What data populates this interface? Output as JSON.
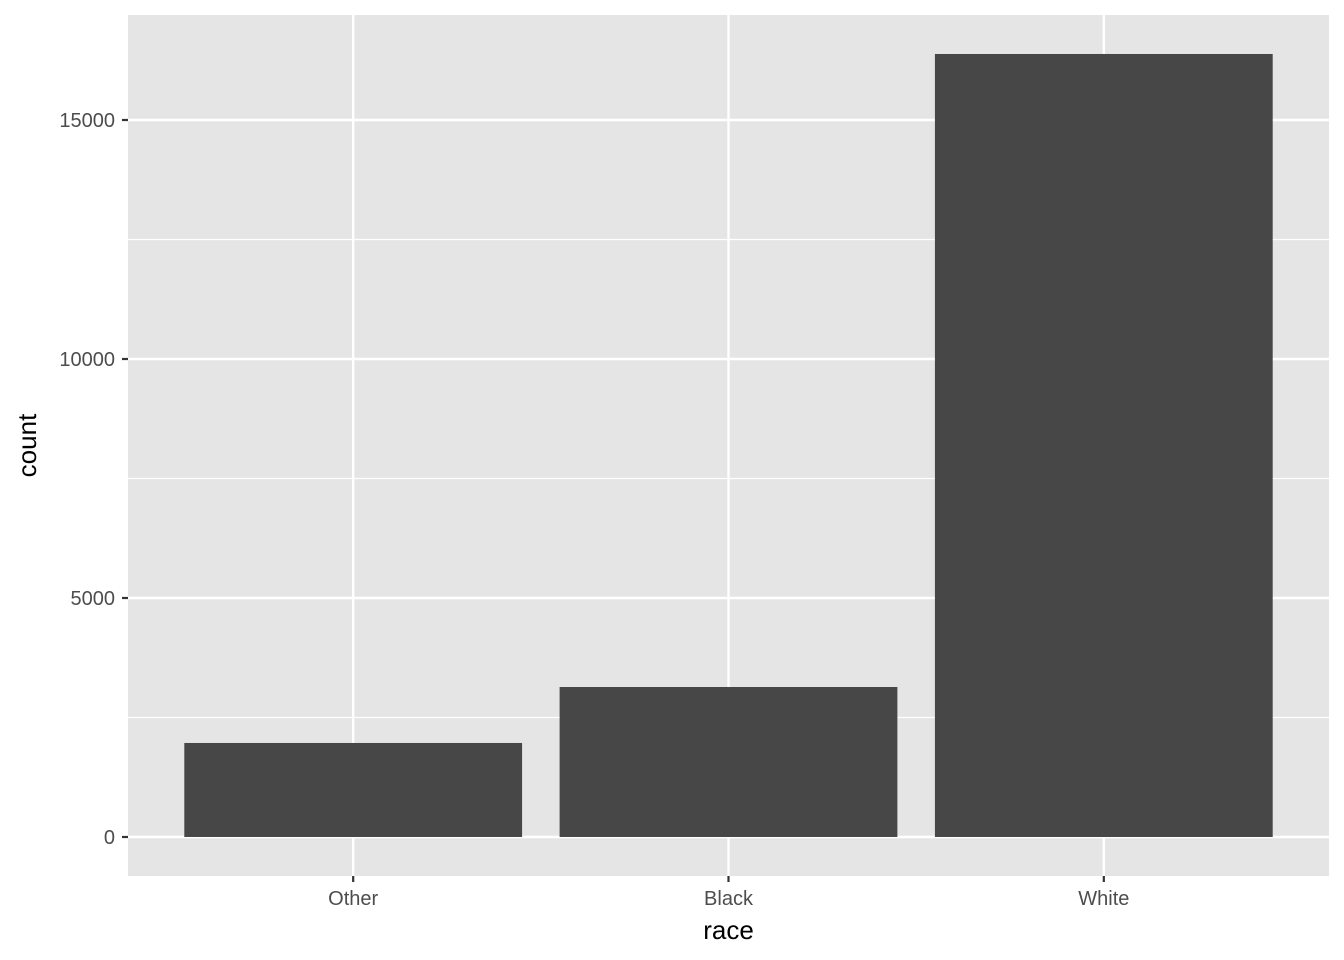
{
  "chart_data": {
    "type": "bar",
    "title": "",
    "xlabel": "race",
    "ylabel": "count",
    "categories": [
      "Other",
      "Black",
      "White"
    ],
    "values": [
      1967,
      3138,
      16381
    ],
    "ylim": [
      -820,
      17200
    ],
    "yticks": [
      0,
      5000,
      10000,
      15000
    ],
    "ytick_labels": [
      "0",
      "5000",
      "10000",
      "15000"
    ],
    "grid": true,
    "legend": "none",
    "colors": {
      "bar": "#474747",
      "panel": "#e5e5e5",
      "grid": "#ffffff",
      "tick_text": "#4d4d4d",
      "tick_mark": "#333333"
    }
  }
}
